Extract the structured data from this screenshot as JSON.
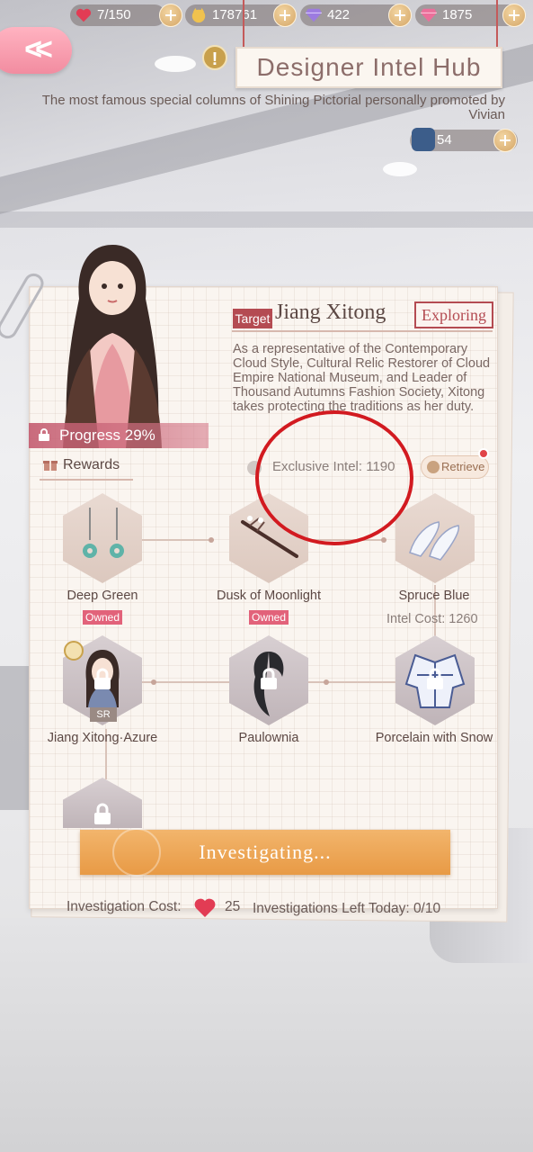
{
  "resources": [
    {
      "icon": "heart-icon",
      "value": "7/150"
    },
    {
      "icon": "cat-coin-icon",
      "value": "178761"
    },
    {
      "icon": "purple-diamond-icon",
      "value": "422"
    },
    {
      "icon": "pink-diamond-icon",
      "value": "1875"
    }
  ],
  "header": {
    "title": "Designer Intel Hub",
    "subtitle": "The most famous special columns of Shining Pictorial personally promoted by Vivian",
    "intel_count": "54"
  },
  "target": {
    "badge": "Target",
    "name": "Jiang Xitong",
    "status": "Exploring",
    "description": "As a representative of the Contemporary Cloud Style, Cultural Relic Restorer of Cloud Empire National Museum, and Leader of Thousand Autumns Fashion Society, Xitong takes protecting the traditions as her duty.",
    "progress_label": "Progress 29%",
    "progress": 0.29
  },
  "rewards": {
    "label": "Rewards",
    "exclusive_intel": "Exclusive Intel: 1190",
    "retrieve_label": "Retrieve",
    "items": [
      {
        "name": "Deep Green",
        "status": "Owned"
      },
      {
        "name": "Dusk of Moonlight",
        "status": "Owned"
      },
      {
        "name": "Spruce Blue",
        "cost": "Intel Cost: 1260"
      },
      {
        "name": "Jiang Xitong·Azure",
        "rarity": "SR"
      },
      {
        "name": "Paulownia"
      },
      {
        "name": "Porcelain with Snow"
      }
    ]
  },
  "actions": {
    "investigate": "Investigating...",
    "cost_label": "Investigation Cost:",
    "cost_value": "25",
    "left_today": "Investigations Left Today: 0/10"
  },
  "colors": {
    "accent_red": "#b44b52",
    "button_orange": "#e89a45",
    "owned_pink": "#e2627a",
    "annotation_red": "#d21a20"
  }
}
